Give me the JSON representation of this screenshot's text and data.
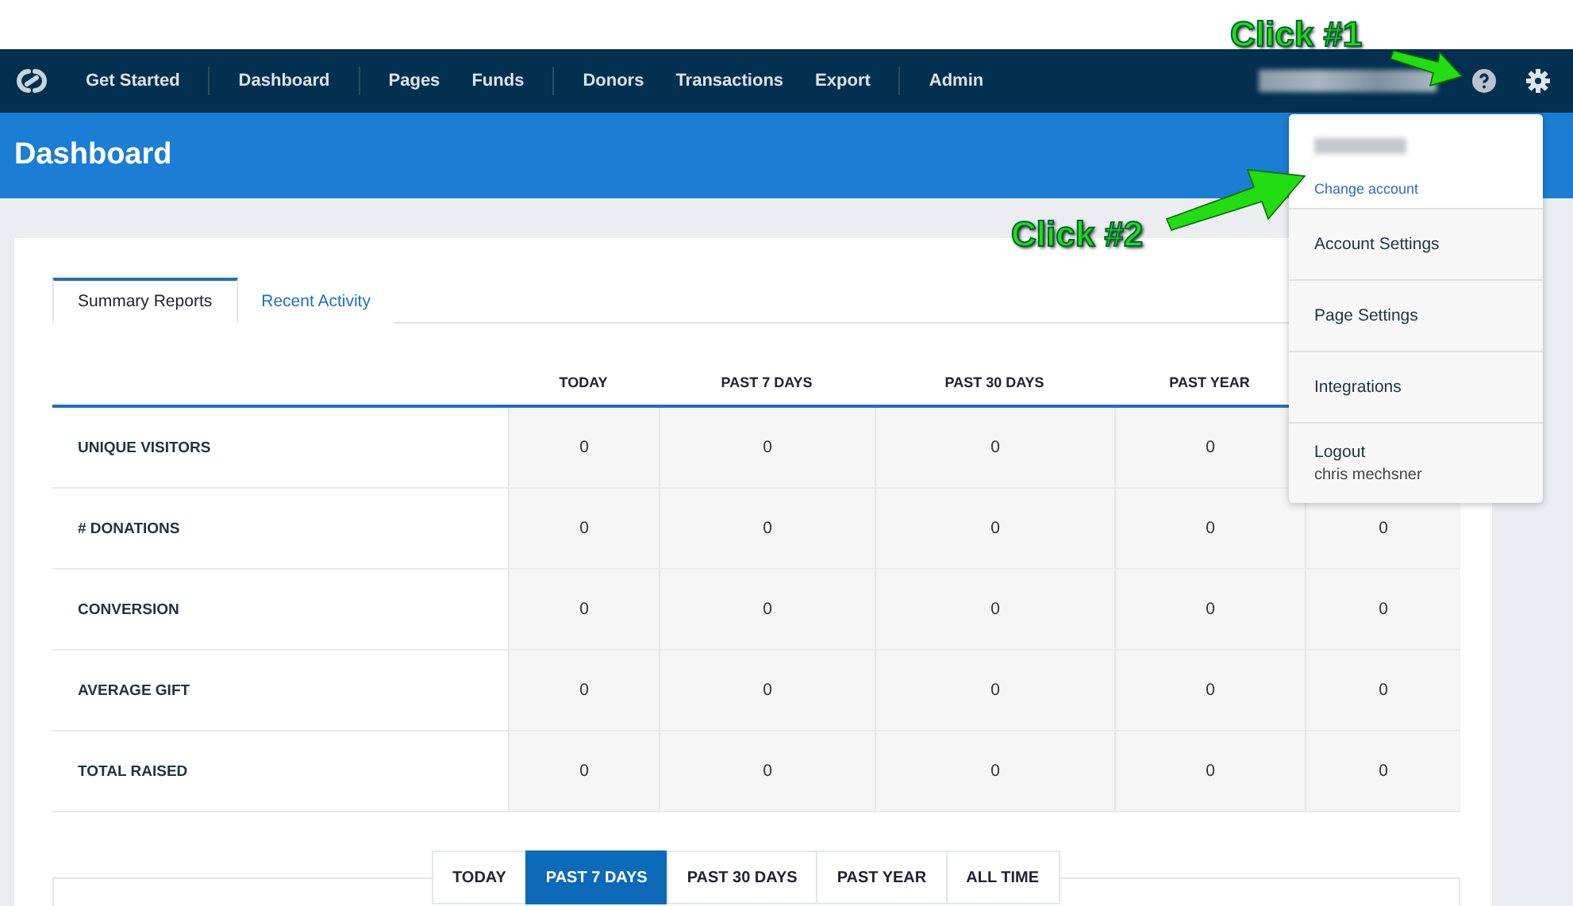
{
  "nav": {
    "groups": [
      {
        "items": [
          {
            "label": "Get Started"
          }
        ]
      },
      {
        "items": [
          {
            "label": "Dashboard"
          }
        ]
      },
      {
        "items": [
          {
            "label": "Pages"
          },
          {
            "label": "Funds"
          }
        ]
      },
      {
        "items": [
          {
            "label": "Donors"
          },
          {
            "label": "Transactions"
          },
          {
            "label": "Export"
          }
        ]
      },
      {
        "items": [
          {
            "label": "Admin"
          }
        ]
      }
    ]
  },
  "page_title": "Dashboard",
  "tabs": [
    {
      "label": "Summary Reports",
      "selected": true
    },
    {
      "label": "Recent Activity",
      "selected": false
    }
  ],
  "table": {
    "columns": [
      "TODAY",
      "PAST 7 DAYS",
      "PAST 30 DAYS",
      "PAST YEAR"
    ],
    "rows": [
      {
        "label": "UNIQUE VISITORS",
        "values": [
          "0",
          "0",
          "0",
          "0"
        ]
      },
      {
        "label": "# DONATIONS",
        "values": [
          "0",
          "0",
          "0",
          "0",
          "0"
        ]
      },
      {
        "label": "CONVERSION",
        "values": [
          "0",
          "0",
          "0",
          "0",
          "0"
        ]
      },
      {
        "label": "AVERAGE GIFT",
        "values": [
          "0",
          "0",
          "0",
          "0",
          "0"
        ]
      },
      {
        "label": "TOTAL RAISED",
        "values": [
          "0",
          "0",
          "0",
          "0",
          "0"
        ]
      }
    ]
  },
  "period_tabs": [
    {
      "label": "TODAY",
      "selected": false
    },
    {
      "label": "PAST 7 DAYS",
      "selected": true
    },
    {
      "label": "PAST 30 DAYS",
      "selected": false
    },
    {
      "label": "PAST YEAR",
      "selected": false
    },
    {
      "label": "ALL TIME",
      "selected": false
    }
  ],
  "account_menu": {
    "link": "Change account",
    "items": [
      {
        "label": "Account Settings"
      },
      {
        "label": "Page Settings"
      },
      {
        "label": "Integrations"
      },
      {
        "label": "Logout",
        "sub": "chris mechsner"
      }
    ]
  },
  "annotations": [
    {
      "label": "Click #1"
    },
    {
      "label": "Click #2"
    }
  ]
}
